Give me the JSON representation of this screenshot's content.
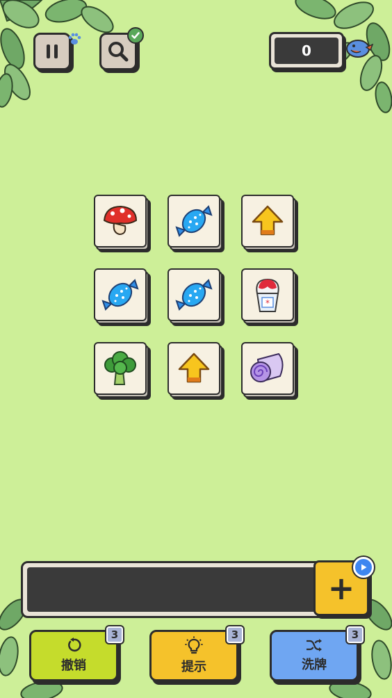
{
  "top_bar": {
    "pause_icon": "pause-icon",
    "search_icon": "magnifier-icon",
    "score": "0"
  },
  "board": {
    "tiles": [
      {
        "item": "mushroom"
      },
      {
        "item": "blue-candy"
      },
      {
        "item": "yellow-arrow-cookie"
      },
      {
        "item": "blue-candy"
      },
      {
        "item": "blue-candy"
      },
      {
        "item": "shaved-ice-cup"
      },
      {
        "item": "broccoli"
      },
      {
        "item": "yellow-arrow-cookie"
      },
      {
        "item": "purple-roll-cake"
      }
    ]
  },
  "tray": {
    "add_label": "+"
  },
  "actions": {
    "undo": {
      "label": "撤销",
      "count": "3"
    },
    "hint": {
      "label": "提示",
      "count": "3"
    },
    "shuffle": {
      "label": "洗牌",
      "count": "3"
    }
  },
  "colors": {
    "background": "#cdef98",
    "undo": "#c5dc2c",
    "hint": "#f5c22b",
    "shuffle": "#6fa6f2"
  }
}
